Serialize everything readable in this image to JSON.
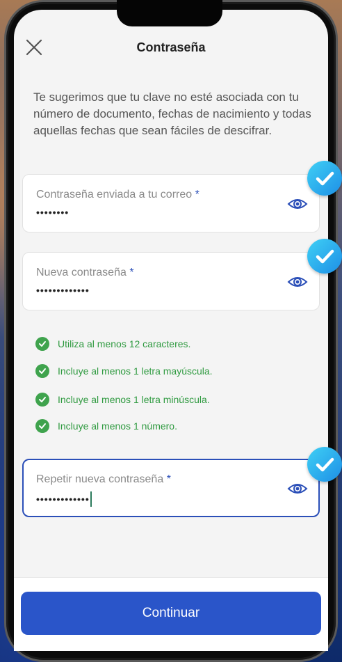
{
  "header": {
    "title": "Contraseña",
    "close_icon": "close-icon"
  },
  "hint": "Te sugerimos que tu clave no esté asociada con tu número de documento, fechas de nacimiento y todas aquellas fechas que sean fáciles de descifrar.",
  "fields": [
    {
      "label": "Contraseña enviada a tu correo",
      "required_mark": "*",
      "value": "••••••••",
      "icon": "eye-icon",
      "validated": true
    },
    {
      "label": "Nueva contraseña",
      "required_mark": "*",
      "value": "•••••••••••••",
      "icon": "eye-icon",
      "validated": true
    },
    {
      "label": "Repetir nueva contraseña",
      "required_mark": "*",
      "value": "•••••••••••••",
      "icon": "eye-icon",
      "validated": true,
      "focused": true
    }
  ],
  "rules": [
    {
      "text": "Utiliza al menos 12 caracteres.",
      "status": "ok"
    },
    {
      "text": "Incluye al menos 1 letra mayúscula.",
      "status": "ok"
    },
    {
      "text": "Incluye al menos 1 letra minúscula.",
      "status": "ok"
    },
    {
      "text": "Incluye al menos 1 número.",
      "status": "ok"
    }
  ],
  "footer": {
    "continue_label": "Continuar"
  },
  "colors": {
    "accent": "#2a55c9",
    "success": "#3fa34d",
    "badge": "#1e8fe6"
  }
}
